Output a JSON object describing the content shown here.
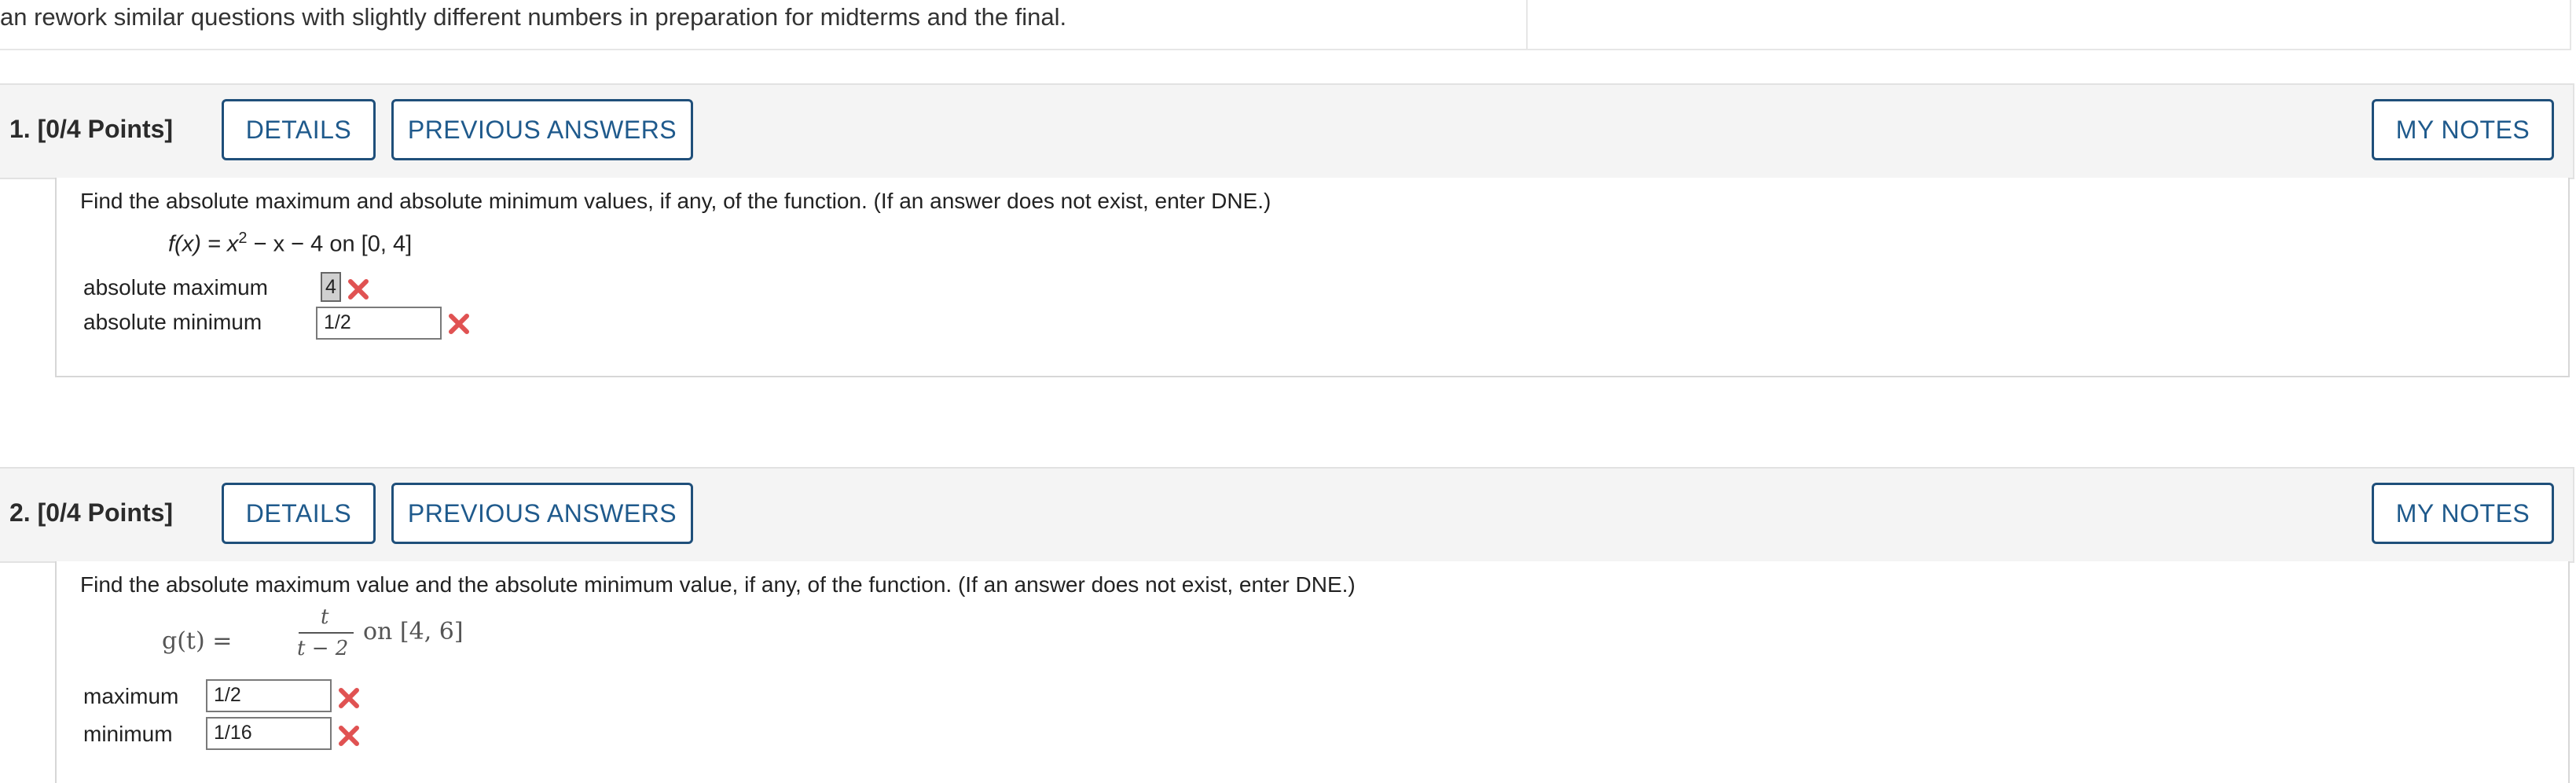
{
  "intro": {
    "text": "an rework similar questions with slightly different numbers in preparation for midterms and the final."
  },
  "questions": [
    {
      "number_label": "1.",
      "points_label": "[0/4 Points]",
      "details_label": "DETAILS",
      "previous_label": "PREVIOUS ANSWERS",
      "notes_label": "MY NOTES",
      "prompt": "Find the absolute maximum and absolute minimum values, if any, of the function. (If an answer does not exist, enter DNE.)",
      "formula_fx": "f(x) = x",
      "formula_exp": "2",
      "formula_rest": " − x − 4 on [0, 4]",
      "answers": [
        {
          "label": "absolute maximum",
          "value": "4",
          "status": "incorrect"
        },
        {
          "label": "absolute minimum",
          "value": "1/2",
          "status": "incorrect"
        }
      ]
    },
    {
      "number_label": "2.",
      "points_label": "[0/4 Points]",
      "details_label": "DETAILS",
      "previous_label": "PREVIOUS ANSWERS",
      "notes_label": "MY NOTES",
      "prompt": "Find the absolute maximum value and the absolute minimum value, if any, of the function. (If an answer does not exist, enter DNE.)",
      "formula_lhs": "g(t) =",
      "formula_num": "t",
      "formula_den": "t − 2",
      "formula_rhs": "on [4, 6]",
      "answers": [
        {
          "label": "maximum",
          "value": "1/2",
          "status": "incorrect"
        },
        {
          "label": "minimum",
          "value": "1/16",
          "status": "incorrect"
        }
      ]
    }
  ],
  "colors": {
    "button_text": "#1f5a8c",
    "button_border": "#1f4f7a",
    "incorrect_mark": "#e05252",
    "header_bg": "#f4f4f4"
  },
  "icons": {
    "incorrect": "x-mark-icon"
  }
}
